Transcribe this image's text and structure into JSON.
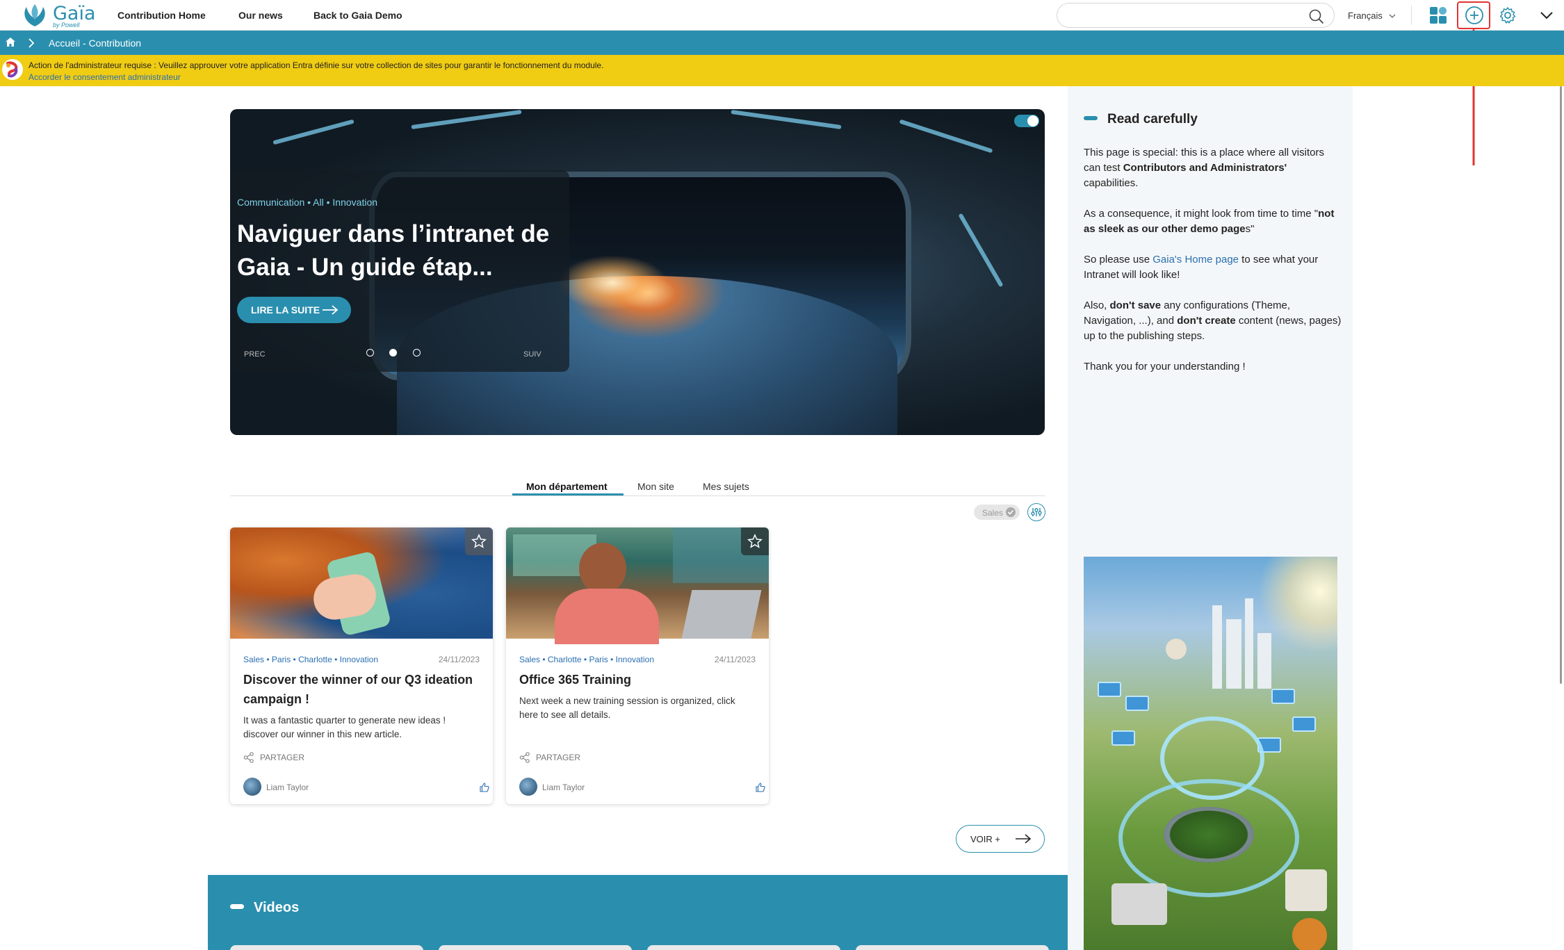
{
  "header": {
    "logo_text": "Gaïa",
    "logo_sub": "by Powell",
    "nav": [
      "Contribution Home",
      "Our news",
      "Back to Gaia Demo"
    ],
    "search_placeholder": "",
    "language": "Français",
    "icons": [
      "apps-icon",
      "add-icon",
      "gear-icon",
      "chevron-down-icon"
    ]
  },
  "breadcrumb": {
    "current": "Accueil - Contribution"
  },
  "warning": {
    "text": "Action de l'administrateur requise : Veuillez approuver votre application Entra définie sur votre collection de sites pour garantir le fonctionnement du module.",
    "link": "Accorder le consentement administrateur",
    "color": "#f0cc13"
  },
  "hero": {
    "tags": "Communication • All • Innovation",
    "title": "Naviguer dans l’intranet de Gaia - Un guide étap...",
    "read_more": "LIRE LA SUITE",
    "prev": "PREC",
    "next": "SUIV",
    "slide_count": 3,
    "active_slide": 2
  },
  "tabs": {
    "items": [
      "Mon département",
      "Mon site",
      "Mes sujets"
    ],
    "active": "Mon département",
    "filter_chip": "Sales"
  },
  "cards": [
    {
      "tags": "Sales  •  Paris  •  Charlotte  •  Innovation",
      "date": "24/11/2023",
      "title": "Discover the winner of our Q3 ideation campaign !",
      "description": "It was a fantastic quarter to generate new ideas ! discover our winner in this new article.",
      "share": "PARTAGER",
      "author": "Liam Taylor",
      "likes": "0"
    },
    {
      "tags": "Sales  •  Charlotte  •  Paris  •  Innovation",
      "date": "24/11/2023",
      "title": "Office 365 Training",
      "description": "Next week a new training session is organized, click here to see all details.",
      "share": "PARTAGER",
      "author": "Liam Taylor",
      "likes": "0"
    }
  ],
  "see_more": "VOIR +",
  "sidebar": {
    "title": "Read carefully",
    "p1_a": "This page is special: this is a place where all visitors can test ",
    "p1_b": "Contributors and Administrators'",
    "p1_c": " capabilities.",
    "p2_a": "As a consequence, it might look from time to time \"",
    "p2_b": "not as sleek as our other demo page",
    "p2_c": "s\"",
    "p3_a": "So please use ",
    "p3_link": "Gaia's Home page",
    "p3_b": " to see what your Intranet will look like!",
    "p4_a": "Also, ",
    "p4_b": "don't save",
    "p4_c": " any configurations (Theme, Navigation, ...), and ",
    "p4_d": "don't create",
    "p4_e": " content (news, pages) up to the publishing steps.",
    "p5": "Thank you for your understanding !"
  },
  "videos": {
    "title": "Videos"
  },
  "colors": {
    "accent": "#2a8fae",
    "highlight": "#e23333"
  }
}
